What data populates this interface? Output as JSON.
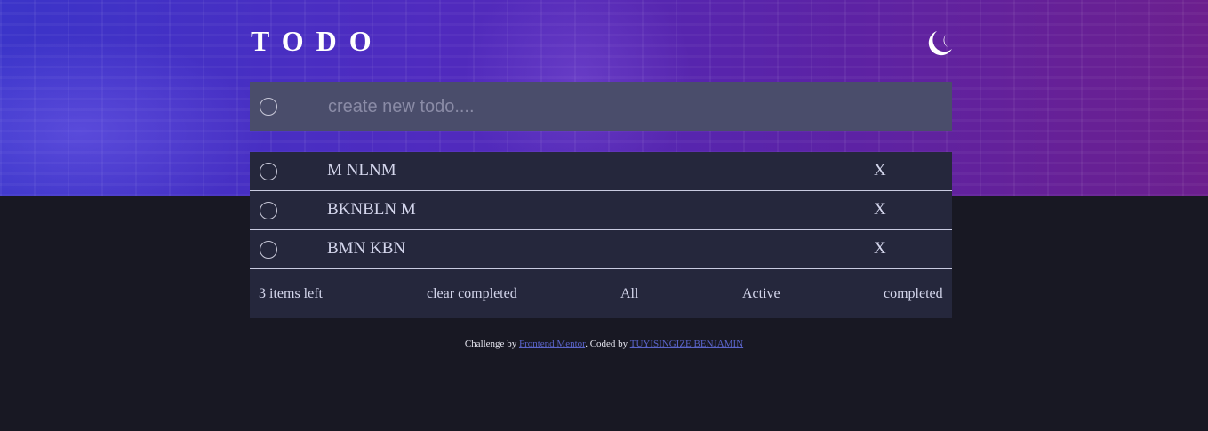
{
  "header": {
    "title": "TODO",
    "theme_icon": "moon-icon"
  },
  "new_todo": {
    "placeholder": "create new todo....",
    "value": ""
  },
  "todos": [
    {
      "text": "M NLNM",
      "delete_label": "X",
      "completed": false
    },
    {
      "text": "BKNBLN M",
      "delete_label": "X",
      "completed": false
    },
    {
      "text": "BMN KBN",
      "delete_label": "X",
      "completed": false
    }
  ],
  "footer": {
    "items_left": "3 items left",
    "clear_completed": "clear completed",
    "filter_all": "All",
    "filter_active": "Active",
    "filter_completed": "completed"
  },
  "credit": {
    "prefix": "Challenge by ",
    "link1": "Frontend Mentor",
    "middle": ". Coded by ",
    "link2": "TUYISINGIZE BENJAMIN"
  },
  "colors": {
    "page_bg": "#181823",
    "panel_bg": "#25273c",
    "input_bg": "#4a4d6b",
    "text": "#d4d6ec",
    "link": "#5a64c8"
  }
}
